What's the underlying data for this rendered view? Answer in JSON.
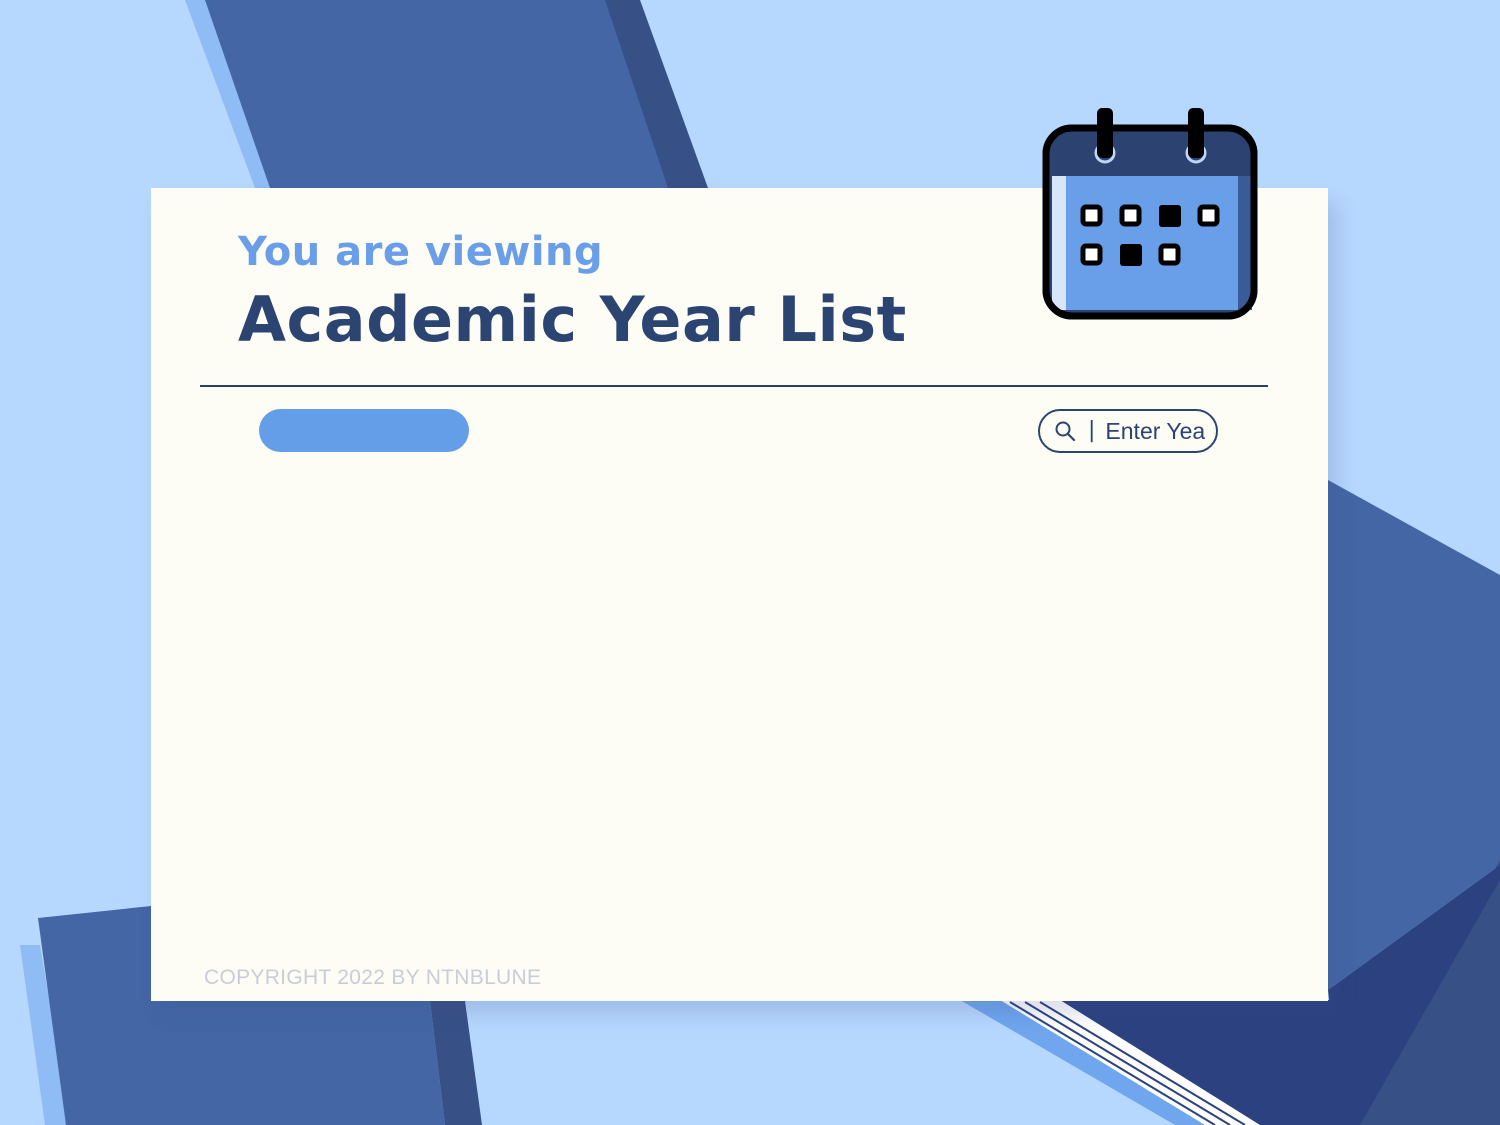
{
  "header": {
    "subtitle": "You are viewing",
    "title": "Academic Year List"
  },
  "toolbar": {
    "action_button_label": "",
    "search": {
      "separator": "|",
      "placeholder": "Enter Year",
      "value": ""
    }
  },
  "footer": {
    "copyright": "COPYRIGHT 2022 BY NTNBLUNE"
  },
  "icons": {
    "calendar": "calendar-icon",
    "search": "search-icon"
  },
  "colors": {
    "background": "#b6d8ff",
    "card": "#fdfdf6",
    "accent": "#659ee8",
    "primary_text": "#2b4472"
  }
}
